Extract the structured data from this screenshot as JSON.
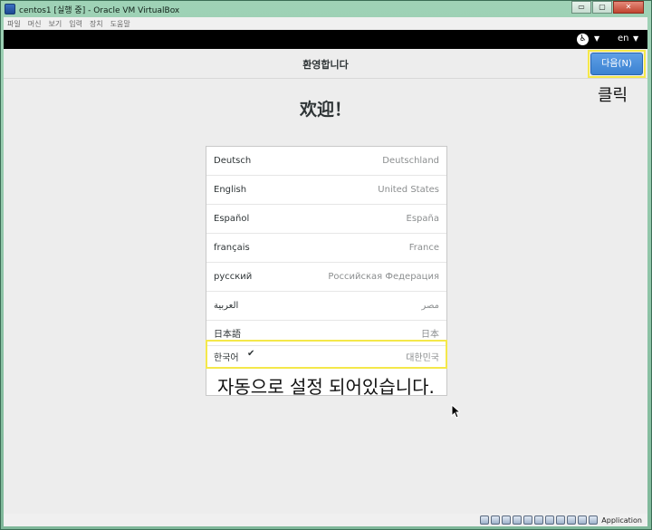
{
  "window": {
    "title": "centos1 [실행 중] - Oracle VM VirtualBox",
    "menu": [
      "파일",
      "머신",
      "보기",
      "입력",
      "장치",
      "도움말"
    ]
  },
  "topbar": {
    "accessibility_icon": "accessibility-icon",
    "language_indicator": "en"
  },
  "header": {
    "title": "환영합니다",
    "next_button": "다음(N)"
  },
  "welcome_heading": "欢迎！",
  "languages": [
    {
      "name": "Deutsch",
      "region": "Deutschland",
      "selected": false
    },
    {
      "name": "English",
      "region": "United States",
      "selected": false
    },
    {
      "name": "Español",
      "region": "España",
      "selected": false
    },
    {
      "name": "français",
      "region": "France",
      "selected": false
    },
    {
      "name": "русский",
      "region": "Российская Федерация",
      "selected": false
    },
    {
      "name": "العربية",
      "region": "مصر",
      "selected": false
    },
    {
      "name": "日本語",
      "region": "日本",
      "selected": false
    },
    {
      "name": "한국어",
      "region": "대한민국",
      "selected": true
    }
  ],
  "selected_mark": "✔",
  "annotations": {
    "click_note": "클릭",
    "auto_note": "자동으로 설정 되어있습니다."
  },
  "statusbar": {
    "host_key": "Application"
  },
  "colors": {
    "highlight": "#f4e84a",
    "next_button": "#3b82d1"
  }
}
